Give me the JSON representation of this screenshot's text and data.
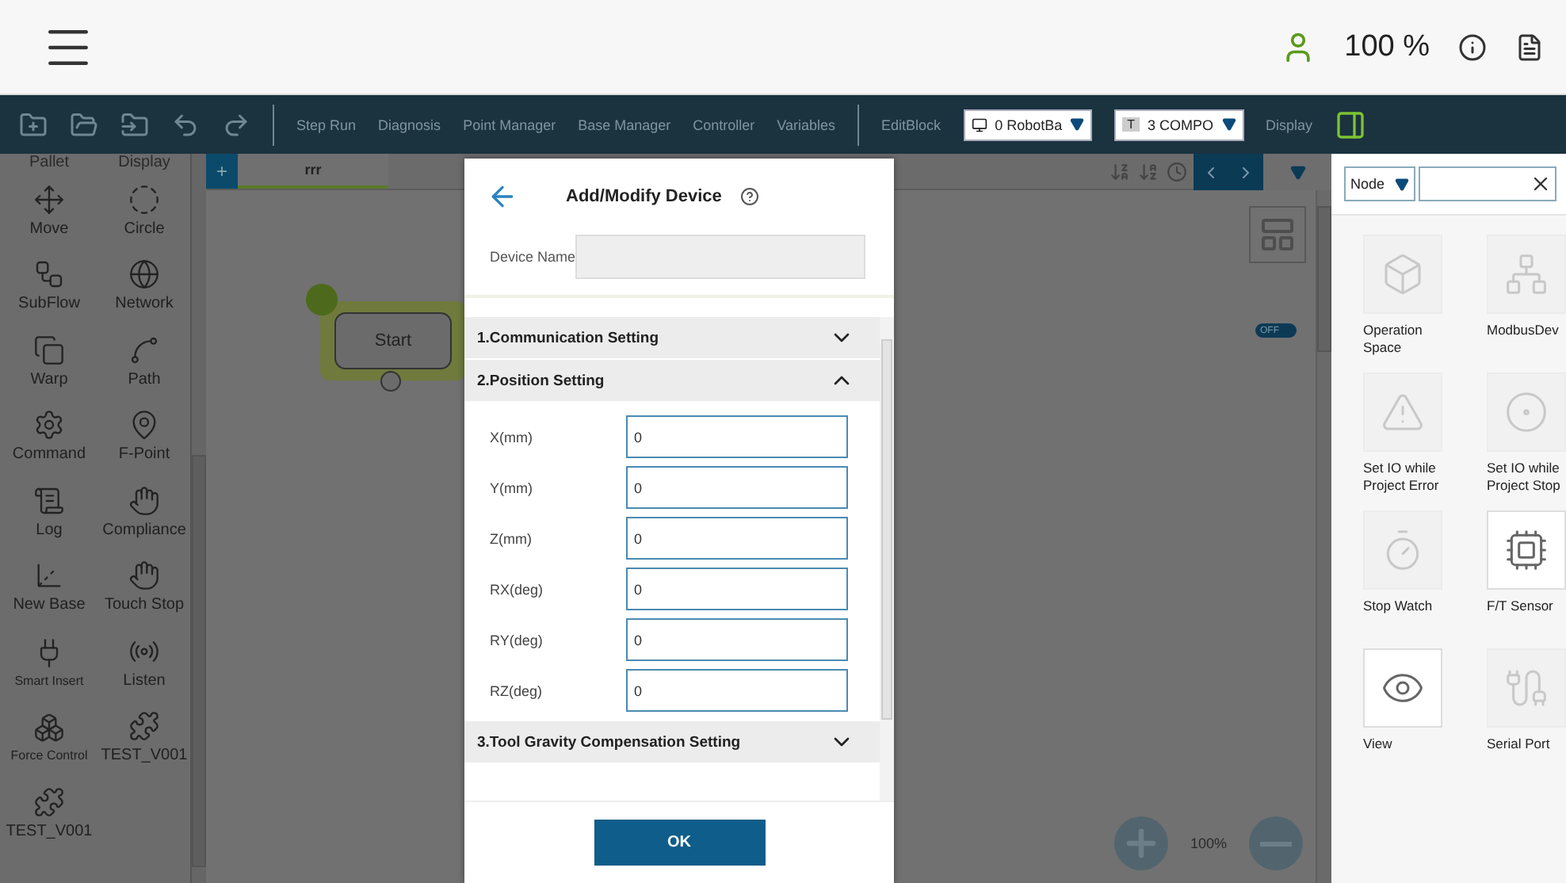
{
  "header": {
    "zoom": "100 %"
  },
  "toolbar": {
    "actions": [
      "Step Run",
      "Diagnosis",
      "Point Manager",
      "Base Manager",
      "Controller",
      "Variables"
    ],
    "edit_block": "EditBlock",
    "robot_select": "0 RobotBa",
    "component_select": {
      "badge": "T",
      "label": "3 COMPO"
    },
    "display": "Display"
  },
  "palette": {
    "headers": [
      "Pallet",
      "Display"
    ],
    "items": [
      {
        "label": "Move"
      },
      {
        "label": "Circle"
      },
      {
        "label": "SubFlow"
      },
      {
        "label": "Network"
      },
      {
        "label": "Warp"
      },
      {
        "label": "Path"
      },
      {
        "label": "Command"
      },
      {
        "label": "F-Point"
      },
      {
        "label": "Log"
      },
      {
        "label": "Compliance"
      },
      {
        "label": "New Base"
      },
      {
        "label": "Touch Stop"
      },
      {
        "label": "Smart Insert"
      },
      {
        "label": "Listen"
      },
      {
        "label": "Force Control"
      },
      {
        "label": "TEST_V001"
      },
      {
        "label": "TEST_V001"
      }
    ]
  },
  "canvas": {
    "add_tab": "+",
    "tabs": [
      {
        "label": "rrr",
        "selected": true
      }
    ],
    "start_node": "Start",
    "sync_toggle": {
      "label": "OFF",
      "on": false
    },
    "zoom": "100%"
  },
  "dialog": {
    "title": "Add/Modify Device",
    "device_name_label": "Device Name",
    "sections": [
      {
        "title": "1.Communication Setting",
        "expanded": false
      },
      {
        "title": "2.Position Setting",
        "expanded": true,
        "fields": [
          {
            "label": "X(mm)",
            "value": "0"
          },
          {
            "label": "Y(mm)",
            "value": "0"
          },
          {
            "label": "Z(mm)",
            "value": "0"
          },
          {
            "label": "RX(deg)",
            "value": "0"
          },
          {
            "label": "RY(deg)",
            "value": "0"
          },
          {
            "label": "RZ(deg)",
            "value": "0"
          }
        ]
      },
      {
        "title": "3.Tool Gravity Compensation Setting",
        "expanded": false
      }
    ],
    "ok": "OK"
  },
  "node_panel": {
    "filter": "Node",
    "nodes": [
      {
        "label": "Operation Space",
        "disabled": true
      },
      {
        "label": "ModbusDev",
        "disabled": true
      },
      {
        "label": "Set IO while Project Error",
        "disabled": true
      },
      {
        "label": "Set IO while Project Stop",
        "disabled": true
      },
      {
        "label": "Stop Watch",
        "disabled": true
      },
      {
        "label": "F/T Sensor",
        "disabled": false
      },
      {
        "label": "View",
        "disabled": false
      },
      {
        "label": "Serial Port",
        "disabled": true
      }
    ]
  }
}
